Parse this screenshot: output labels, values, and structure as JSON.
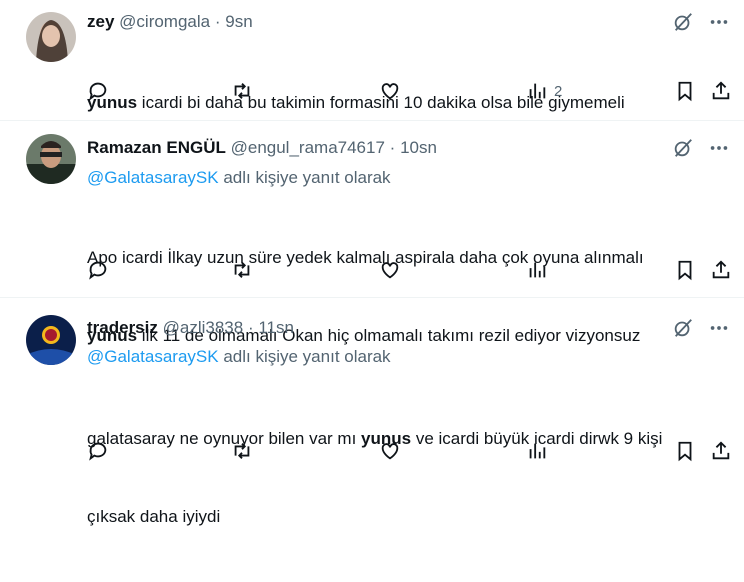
{
  "tweets": [
    {
      "name": "zey",
      "handle": "@ciromgala",
      "dot": "·",
      "time": "9sn",
      "reply_prefix": "",
      "reply_mention": "",
      "reply_suffix": "",
      "lines": [
        [
          {
            "t": "yunus",
            "b": true
          },
          {
            "t": " icardi bi daha bu takimin formasini 10 dakika olsa bile giymemeli",
            "b": false
          }
        ]
      ],
      "views": "2"
    },
    {
      "name": "Ramazan ENGÜL",
      "handle": "@engul_rama74617",
      "dot": "·",
      "time": "10sn",
      "reply_prefix": "",
      "reply_mention": "@GalatasaraySK",
      "reply_suffix": " adlı kişiye yanıt olarak",
      "lines": [
        [
          {
            "t": "Apo icardi İlkay uzun süre yedek kalmalı aspirala daha çok oyuna alınmalı",
            "b": false
          }
        ],
        [
          {
            "t": "yunus",
            "b": true
          },
          {
            "t": " ilk 11 de olmamalı Okan hiç olmamalı takımı rezil ediyor vizyonsuz",
            "b": false
          }
        ]
      ],
      "views": ""
    },
    {
      "name": "tradersiz",
      "handle": "@azli3838",
      "dot": "·",
      "time": "11sn",
      "reply_prefix": "",
      "reply_mention": "@GalatasaraySK",
      "reply_suffix": " adlı kişiye yanıt olarak",
      "lines": [
        [
          {
            "t": "galatasaray ne oynuyor bilen var mı ",
            "b": false
          },
          {
            "t": "yunus",
            "b": true
          },
          {
            "t": " ve icardi büyük icardi dirwk 9 kişi",
            "b": false
          }
        ],
        [
          {
            "t": "çıksak daha iyiydi",
            "b": false
          }
        ]
      ],
      "views": ""
    }
  ],
  "icons": {
    "grok": "grok-icon",
    "more": "more-icon",
    "reply": "reply-icon",
    "retweet": "retweet-icon",
    "like": "like-icon",
    "views": "views-icon",
    "bookmark": "bookmark-icon",
    "share": "share-icon"
  },
  "colors": {
    "text": "#0f1419",
    "muted": "#536471",
    "link": "#1d9bf0",
    "divider": "#eff3f4"
  }
}
